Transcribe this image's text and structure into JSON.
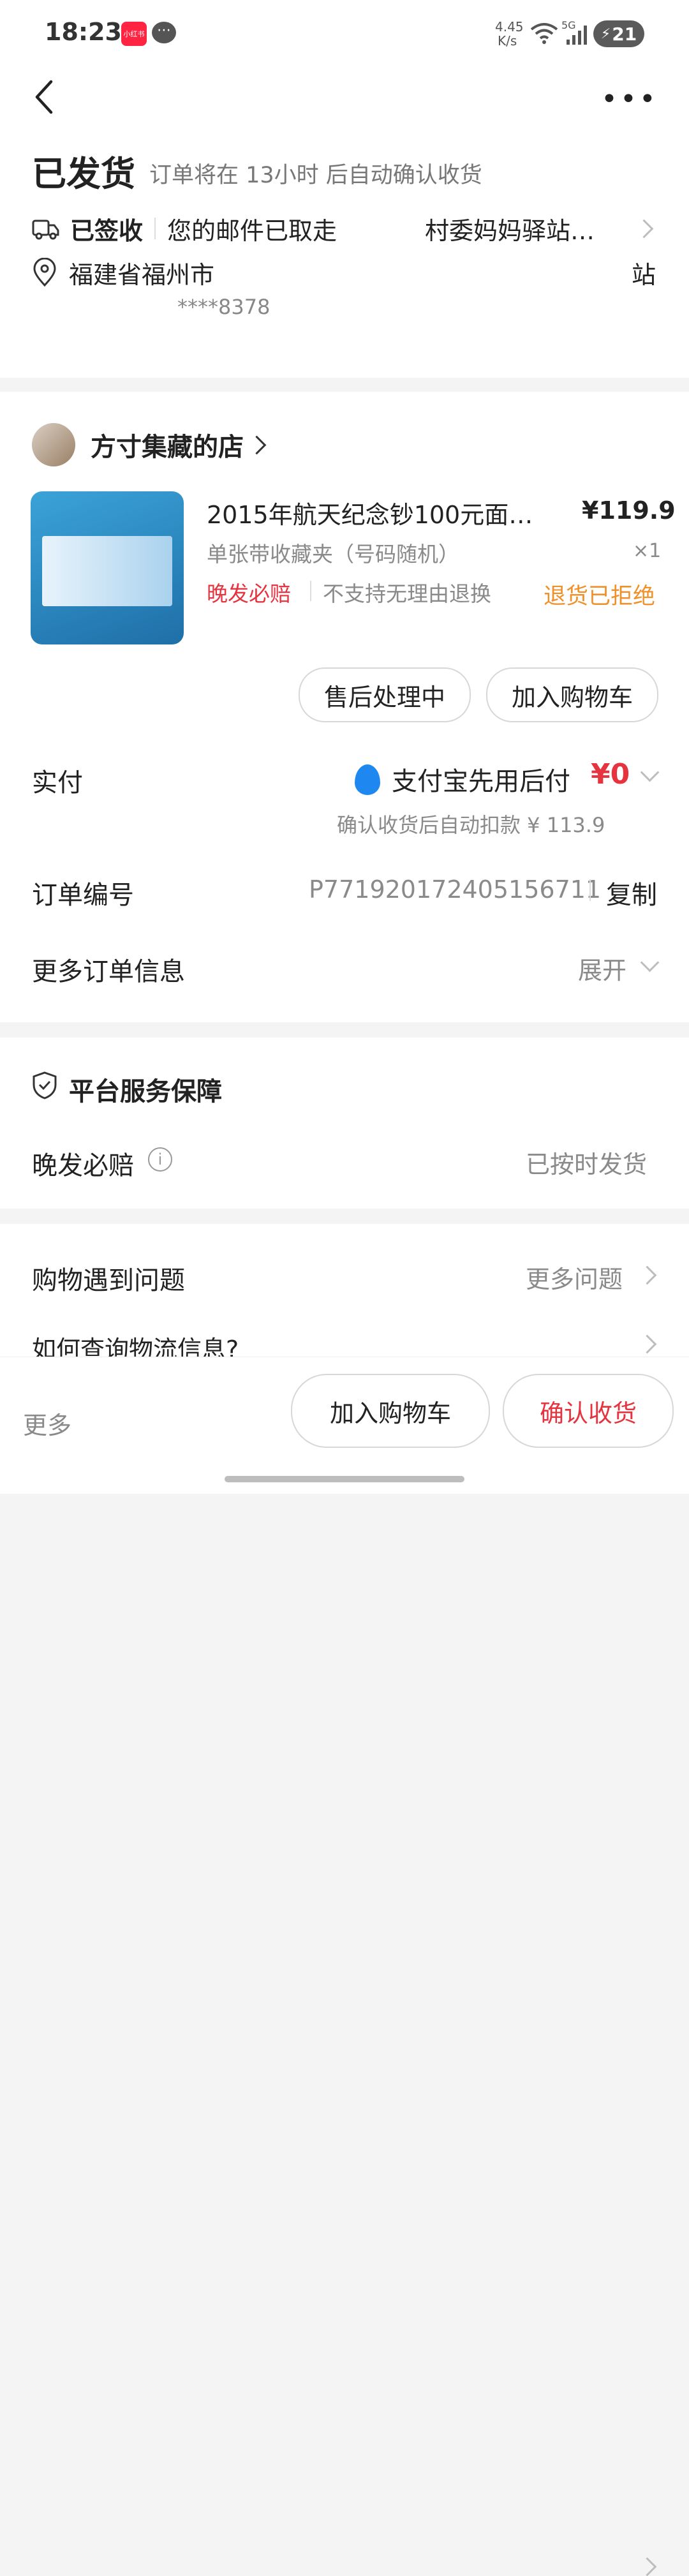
{
  "status_bar": {
    "time": "18:23",
    "app_badge": "小红书",
    "net_speed_value": "4.45",
    "net_speed_unit": "K/s",
    "signal_label": "5G",
    "battery": "21",
    "battery_color": "#5a5a5a"
  },
  "order_status": {
    "title": "已发货",
    "auto_confirm": "订单将在 13小时 后自动确认收货"
  },
  "logistics": {
    "label": "已签收",
    "detail": "您的邮件已取走",
    "station": "村委妈妈驿站…"
  },
  "address": {
    "line1_start": "福建省福州市",
    "line1_end": "站",
    "phone": "****8378"
  },
  "shop": {
    "name": "方寸集藏的店"
  },
  "product": {
    "title": "2015年航天纪念钞100元面…",
    "variant": "单张带收藏夹（号码随机）",
    "price": "¥119.9",
    "quantity": "×1",
    "tag_late": "晚发必赔",
    "tag_no_return": "不支持无理由退换",
    "return_status": "退货已拒绝",
    "brand_red": "#e5343f",
    "warn_orange": "#f0902a"
  },
  "actions": {
    "after_sale": "售后处理中",
    "add_cart": "加入购物车"
  },
  "payment": {
    "label": "实付",
    "method": "支付宝先用后付",
    "amount": "¥0",
    "auto_deduct": "确认收货后自动扣款 ¥ 113.9"
  },
  "order_number": {
    "label": "订单编号",
    "value": "P771920172405156711",
    "copy": "复制"
  },
  "more_info": {
    "label": "更多订单信息",
    "expand": "展开"
  },
  "guarantee": {
    "title": "平台服务保障",
    "item_label": "晚发必赔",
    "item_status": "已按时发货"
  },
  "help": {
    "title": "购物遇到问题",
    "more": "更多问题",
    "question": "如何查询物流信息?"
  },
  "bottom_bar": {
    "more": "更多",
    "add_cart": "加入购物车",
    "confirm": "确认收货"
  }
}
